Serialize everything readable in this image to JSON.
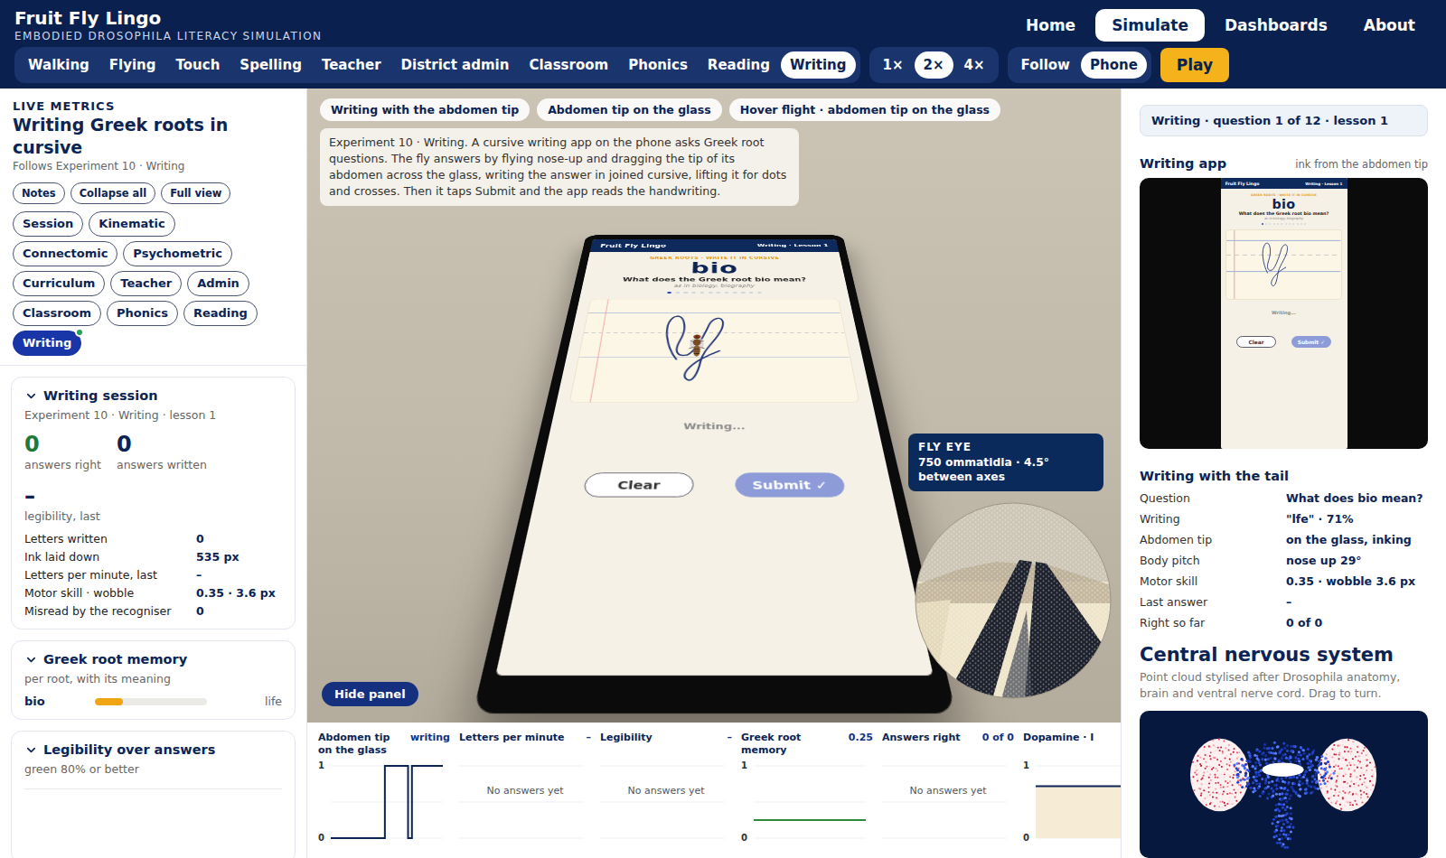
{
  "app": {
    "title": "Fruit Fly Lingo",
    "tagline": "EMBODIED DROSOPHILA LITERACY SIMULATION"
  },
  "nav": [
    {
      "label": "Home",
      "selected": false
    },
    {
      "label": "Simulate",
      "selected": true
    },
    {
      "label": "Dashboards",
      "selected": false
    },
    {
      "label": "About",
      "selected": false
    }
  ],
  "modes": [
    {
      "label": "Walking",
      "selected": false
    },
    {
      "label": "Flying",
      "selected": false
    },
    {
      "label": "Touch",
      "selected": false
    },
    {
      "label": "Spelling",
      "selected": false
    },
    {
      "label": "Teacher",
      "selected": false
    },
    {
      "label": "District admin",
      "selected": false
    },
    {
      "label": "Classroom",
      "selected": false
    },
    {
      "label": "Phonics",
      "selected": false
    },
    {
      "label": "Reading",
      "selected": false
    },
    {
      "label": "Writing",
      "selected": true
    }
  ],
  "speeds": [
    {
      "label": "1×",
      "selected": false
    },
    {
      "label": "2×",
      "selected": true
    },
    {
      "label": "4×",
      "selected": false
    }
  ],
  "views": [
    {
      "label": "Follow",
      "selected": false
    },
    {
      "label": "Phone",
      "selected": true
    }
  ],
  "play": {
    "label": "Play"
  },
  "sidebar": {
    "eyebrow": "LIVE METRICS",
    "title": "Writing Greek roots in cursive",
    "subtitle": "Follows Experiment 10 · Writing",
    "actions": [
      "Notes",
      "Collapse all",
      "Full view"
    ],
    "chips": [
      {
        "label": "Session",
        "selected": false,
        "live": false
      },
      {
        "label": "Kinematic",
        "selected": false,
        "live": false
      },
      {
        "label": "Connectomic",
        "selected": false,
        "live": false
      },
      {
        "label": "Psychometric",
        "selected": false,
        "live": false
      },
      {
        "label": "Curriculum",
        "selected": false,
        "live": false
      },
      {
        "label": "Teacher",
        "selected": false,
        "live": false
      },
      {
        "label": "Admin",
        "selected": false,
        "live": false
      },
      {
        "label": "Classroom",
        "selected": false,
        "live": false
      },
      {
        "label": "Phonics",
        "selected": false,
        "live": false
      },
      {
        "label": "Reading",
        "selected": false,
        "live": false
      },
      {
        "label": "Writing",
        "selected": true,
        "live": true
      }
    ],
    "session": {
      "title": "Writing session",
      "expanded": true,
      "subtitle": "Experiment 10 · Writing · lesson 1",
      "stats": [
        {
          "value": "0",
          "label": "answers right",
          "color": "#1f7a3a"
        },
        {
          "value": "0",
          "label": "answers written",
          "color": "#0b2454"
        }
      ],
      "headline": {
        "value": "–",
        "label": "legibility, last"
      },
      "rows": [
        {
          "label": "Letters written",
          "value": "0"
        },
        {
          "label": "Ink laid down",
          "value": "535 px"
        },
        {
          "label": "Letters per minute, last",
          "value": "–"
        },
        {
          "label": "Motor skill · wobble",
          "value": "0.35 · 3.6 px"
        },
        {
          "label": "Misread by the recogniser",
          "value": "0"
        }
      ]
    },
    "memory": {
      "title": "Greek root memory",
      "expanded": true,
      "subtitle": "per root, with its meaning",
      "roots": [
        {
          "root": "bio",
          "meaning": "life",
          "level": 0.25
        }
      ]
    },
    "legibility": {
      "title": "Legibility over answers",
      "expanded": true,
      "subtitle": "green 80% or better"
    }
  },
  "scene": {
    "chips": [
      "Writing with the abdomen tip",
      "Abdomen tip on the glass",
      "Hover flight · abdomen tip on the glass"
    ],
    "caption": "Experiment 10 · Writing. A cursive writing app on the phone asks Greek root questions. The fly answers by flying nose-up and dragging the tip of its abdomen across the glass, writing the answer in joined cursive, lifting it for dots and crosses. Then it taps Submit and the app reads the handwriting.",
    "fly_eye": {
      "title": "FLY EYE",
      "detail": "750 ommatidia · 4.5° between axes"
    },
    "hide_button": "Hide panel"
  },
  "phone_app": {
    "brand": "Fruit Fly Lingo",
    "lesson": "Writing · Lesson 1",
    "kicker": "GREEK ROOTS · WRITE IT IN CURSIVE",
    "word": "bio",
    "question": "What does the Greek root bio mean?",
    "hint": "as in biology, biography",
    "dots": [
      {
        "selected": true
      },
      {
        "selected": false
      },
      {
        "selected": false
      },
      {
        "selected": false
      },
      {
        "selected": false
      },
      {
        "selected": false
      },
      {
        "selected": false
      },
      {
        "selected": false
      },
      {
        "selected": false
      },
      {
        "selected": false
      },
      {
        "selected": false
      },
      {
        "selected": false
      }
    ],
    "status": "Writing...",
    "buttons": [
      {
        "label": "Clear",
        "kind": "outline"
      },
      {
        "label": "Submit ✓",
        "kind": "primary"
      }
    ]
  },
  "charts": [
    {
      "title": "Abdomen tip on the glass",
      "value": "writing",
      "kind": "step",
      "ticks": [
        "1",
        "0"
      ],
      "values": [
        0,
        0,
        0,
        0,
        0,
        0,
        0,
        0,
        0,
        0,
        0,
        0,
        0,
        0,
        1,
        1,
        1,
        1,
        1,
        1,
        0,
        1,
        1,
        1,
        1,
        1,
        1,
        1,
        1,
        1
      ]
    },
    {
      "title": "Letters per minute",
      "value": "–",
      "kind": "empty",
      "empty": "No answers yet"
    },
    {
      "title": "Legibility",
      "value": "–",
      "kind": "empty",
      "empty": "No answers yet"
    },
    {
      "title": "Greek root memory",
      "value": "0.25",
      "kind": "line",
      "ticks": [
        "1",
        "0"
      ],
      "values": [
        0.25,
        0.25,
        0.25,
        0.25,
        0.25,
        0.25,
        0.25,
        0.25,
        0.25,
        0.25
      ]
    },
    {
      "title": "Answers right",
      "value": "0 of 0",
      "kind": "empty",
      "empty": "No answers yet"
    },
    {
      "title": "Dopamine · I",
      "kind": "area",
      "ticks": [
        "1",
        "0"
      ],
      "values": [
        0.72,
        0.72,
        0.72,
        0.72,
        0.72,
        0.72,
        0.72,
        0.72,
        0.72,
        0.72
      ]
    }
  ],
  "right_panel": {
    "banner": "Writing · question 1 of 12 · lesson 1",
    "app_title": "Writing app",
    "app_note": "ink from the abdomen tip",
    "details_title": "Writing with the tail",
    "details": [
      {
        "label": "Question",
        "value": "What does bio mean?"
      },
      {
        "label": "Writing",
        "value": "\"lfe\" · 71%"
      },
      {
        "label": "Abdomen tip",
        "value": "on the glass, inking"
      },
      {
        "label": "Body pitch",
        "value": "nose up 29°"
      },
      {
        "label": "Motor skill",
        "value": "0.35 · wobble 3.6 px"
      },
      {
        "label": "Last answer",
        "value": "–"
      },
      {
        "label": "Right so far",
        "value": "0 of 0"
      }
    ],
    "cns_title": "Central nervous system",
    "cns_desc": "Point cloud stylised after Drosophila anatomy, brain and ventral nerve cord. Drag to turn."
  }
}
